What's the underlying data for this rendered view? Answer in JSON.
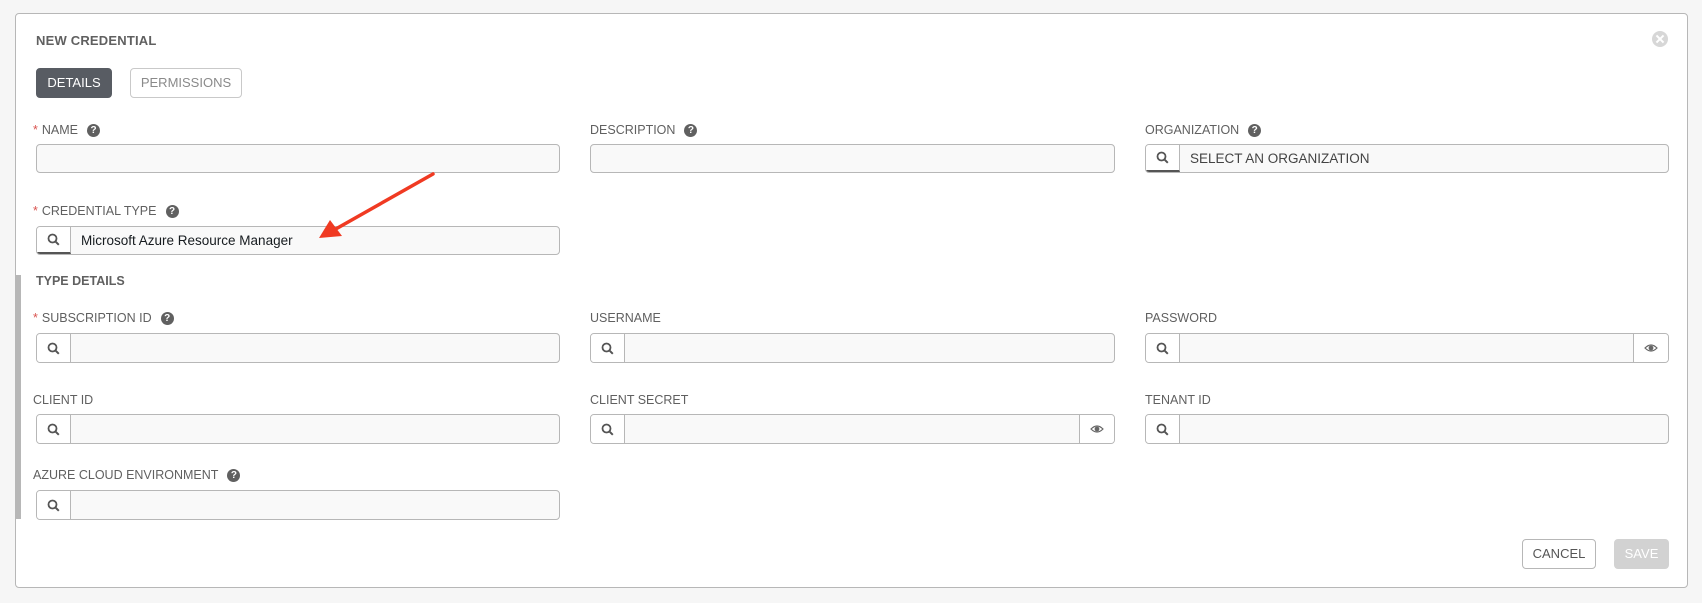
{
  "dialog": {
    "title": "NEW CREDENTIAL",
    "close_icon": "close-circle-icon"
  },
  "tabs": [
    {
      "label": "DETAILS",
      "active": true
    },
    {
      "label": "PERMISSIONS",
      "active": false
    }
  ],
  "fields": {
    "name": {
      "label": "NAME",
      "required": "*",
      "value": "",
      "help": "?"
    },
    "description": {
      "label": "DESCRIPTION",
      "value": "",
      "help": "?"
    },
    "organization": {
      "label": "ORGANIZATION",
      "placeholder": "SELECT AN ORGANIZATION",
      "help": "?"
    },
    "credential_type": {
      "label": "CREDENTIAL TYPE",
      "required": "*",
      "value": "Microsoft Azure Resource Manager",
      "help": "?"
    }
  },
  "type_details": {
    "heading": "TYPE DETAILS",
    "subscription_id": {
      "label": "SUBSCRIPTION ID",
      "required": "*",
      "value": "",
      "help": "?"
    },
    "username": {
      "label": "USERNAME",
      "value": ""
    },
    "password": {
      "label": "PASSWORD",
      "value": ""
    },
    "client_id": {
      "label": "CLIENT ID",
      "value": ""
    },
    "client_secret": {
      "label": "CLIENT SECRET",
      "value": ""
    },
    "tenant_id": {
      "label": "TENANT ID",
      "value": ""
    },
    "azure_cloud_environment": {
      "label": "AZURE CLOUD ENVIRONMENT",
      "value": "",
      "help": "?"
    }
  },
  "actions": {
    "cancel_label": "CANCEL",
    "save_label": "SAVE"
  },
  "annotation": {
    "arrow_color": "#f03a22",
    "points_to": "credential-type-field"
  }
}
